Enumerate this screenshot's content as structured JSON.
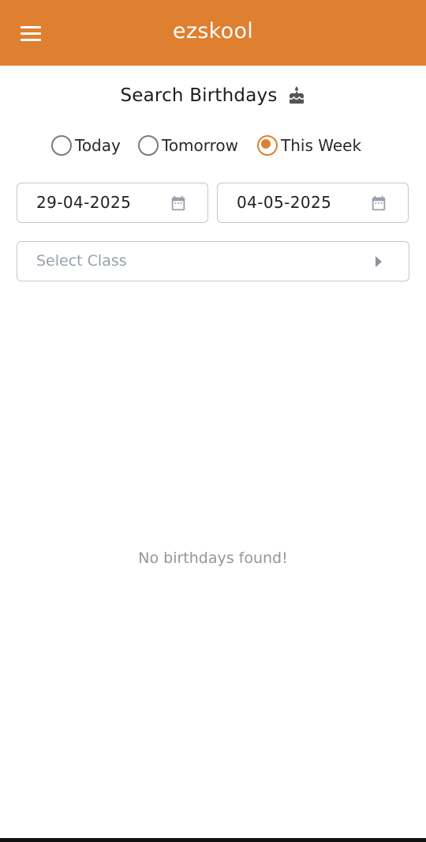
{
  "appbar": {
    "title": "ezskool",
    "menu_icon": "hamburger-menu-icon",
    "color": "#DF7F30"
  },
  "page": {
    "heading": "Search Birthdays",
    "heading_icon": "birthday-cake-icon"
  },
  "range_options": [
    {
      "label": "Today",
      "selected": false
    },
    {
      "label": "Tomorrow",
      "selected": false
    },
    {
      "label": "This Week",
      "selected": true
    }
  ],
  "date_range": {
    "from": "29-04-2025",
    "to": "04-05-2025",
    "icon": "calendar-icon"
  },
  "class_select": {
    "placeholder": "Select Class",
    "icon": "arrow-right-icon"
  },
  "results": {
    "empty_message": "No birthdays found!"
  }
}
